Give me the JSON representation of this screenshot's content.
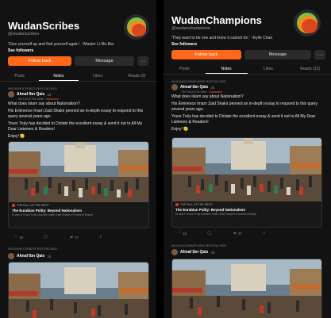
{
  "left": {
    "title": "WudanScribes",
    "handle": "@wudanscribes",
    "quote": "'Give yourself up and find yourself again.' ~Master Li Mu Bai",
    "followers": "See followers",
    "follow_label": "Follow back",
    "message_label": "Message",
    "more_label": "···",
    "tabs": [
      "Posts",
      "Notes",
      "Likes",
      "Reads (9)"
    ],
    "restack": "WUDANSCRIBES RESTACKED",
    "author": "Ahnaf Ibn Qais",
    "time": "3d",
    "sub_prefix": "The Fall of The West",
    "sub_tag": "Subscriber",
    "body": [
      "What does Islam say about Nationalism?",
      "His Eminence Imam Zaid Shakir penned an in-depth essay to respond to this query several years ago.",
      "Yours Truly has decided to Dictate the excellent essay & send it out to All My Dear Listeners & Readers!",
      "Enjoy! 🫡"
    ],
    "card_pub": "THE FALL OF THE WEST",
    "card_title": "The Eurabian Polity: Beyond Nationalism",
    "card_sub": "In which Yours Truly Dictates Imam Zaid Shakir's Excellent Essay!",
    "likes": "18",
    "comments": "",
    "restacks": "37",
    "author2": "Ahnaf Ibn Qais",
    "time2": "3d",
    "restack2": "WUDANSCRIBES RESTACKED"
  },
  "right": {
    "title": "WudanChampions",
    "handle": "@wudanchampions",
    "quote": "'They want to be one and know it cannot be.' ~Eylie Chan",
    "followers": "See followers",
    "follow_label": "Follow back",
    "message_label": "Message",
    "more_label": "···",
    "tabs": [
      "Posts",
      "Notes",
      "Likes",
      "Reads (12)"
    ],
    "restack": "WUDANCHAMPIONS RESTACKED",
    "author": "Ahnaf Ibn Qais",
    "time": "3d",
    "sub_prefix": "The Fall of The West",
    "sub_tag": "Subscriber",
    "body": [
      "What does Islam say about Nationalism?",
      "His Eminence Imam Zaid Shakir penned an in-depth essay to respond to this query several years ago.",
      "Yours Truly has decided to Dictate the excellent essay & send it out to All My Dear Listeners & Readers!",
      "Enjoy! 🫡"
    ],
    "card_pub": "THE FALL OF THE WEST",
    "card_title": "The Eurabian Polity: Beyond Nationalism",
    "card_sub": "In which Yours Truly Dictates Imam Zaid Shakir's Excellent Essay!",
    "likes": "18",
    "comments": "",
    "restacks": "37",
    "author2": "Ahnaf Ibn Qais",
    "time2": "3d",
    "restack2": "WUDANCHAMPIONS RESTACKED"
  },
  "colors": {
    "accent": "#ff6719",
    "background": "#121212"
  }
}
